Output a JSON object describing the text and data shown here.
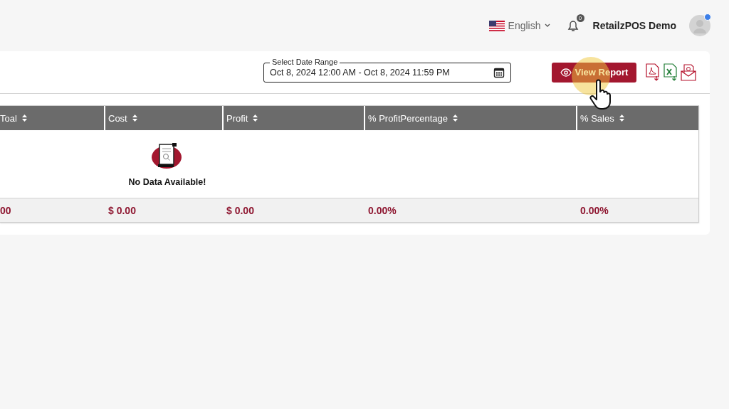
{
  "header": {
    "language": "English",
    "notifications": "0",
    "user": "RetailzPOS Demo",
    "user_online": true
  },
  "filter": {
    "label": "Select Date Range",
    "value": "Oct 8, 2024 12:00 AM - Oct 8, 2024 11:59 PM"
  },
  "view_button": "View Report",
  "table": {
    "columns": [
      "Toal",
      "Cost",
      "Profit",
      "% ProfitPercentage",
      "% Sales"
    ],
    "empty_message": "No Data Available!",
    "totals": [
      "00",
      "$ 0.00",
      "$ 0.00",
      "0.00%",
      "0.00%"
    ]
  }
}
